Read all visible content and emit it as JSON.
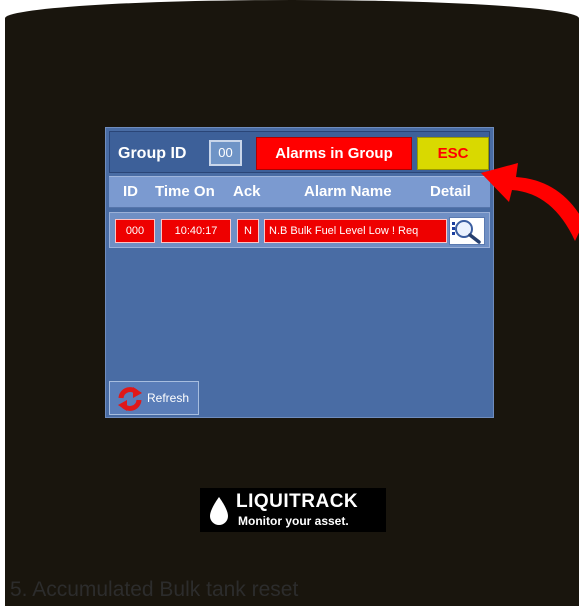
{
  "header": {
    "group_label": "Group ID",
    "group_value": "00",
    "alarms_label": "Alarms in Group",
    "esc_label": "ESC"
  },
  "columns": [
    "ID",
    "Time On",
    "Ack",
    "Alarm Name",
    "Detail"
  ],
  "alarm_rows": [
    {
      "id": "000",
      "time_on": "10:40:17",
      "ack": "N",
      "name": "N.B Bulk Fuel Level Low ! Req"
    }
  ],
  "refresh_label": "Refresh",
  "logo": {
    "brand": "LIQUITRACK",
    "tagline": "Monitor your asset."
  },
  "caption": "5. Accumulated Bulk tank reset",
  "icons": {
    "detail": "magnifier-icon",
    "refresh": "refresh-icon",
    "logo": "droplet-icon",
    "annotation": "red-arrow"
  },
  "colors": {
    "background": "#19150d",
    "panel": "#496ca4",
    "alarm_red": "#ff0000",
    "esc_yellow": "#d9d900",
    "column_header": "#7b9ad0"
  }
}
